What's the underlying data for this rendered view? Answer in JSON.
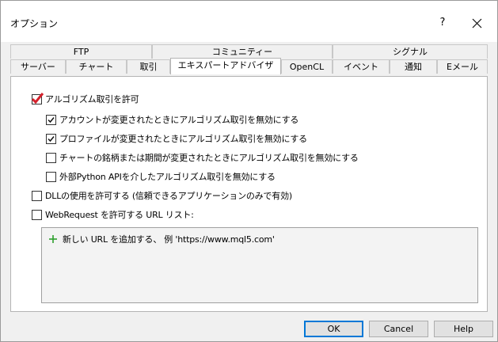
{
  "window": {
    "title": "オプション",
    "help_label": "?"
  },
  "tabs": {
    "row1": [
      {
        "label": "FTP"
      },
      {
        "label": "コミュニティー"
      },
      {
        "label": "シグナル"
      }
    ],
    "row2": [
      {
        "label": "サーバー"
      },
      {
        "label": "チャート"
      },
      {
        "label": "取引"
      },
      {
        "label": "エキスパートアドバイザ",
        "active": true
      },
      {
        "label": "OpenCL"
      },
      {
        "label": "イベント"
      },
      {
        "label": "通知"
      },
      {
        "label": "Eメール"
      }
    ]
  },
  "options": {
    "allow_algo": {
      "label": "アルゴリズム取引を許可",
      "checked": true
    },
    "disable_on_account": {
      "label": "アカウントが変更されたときにアルゴリズム取引を無効にする",
      "checked": true
    },
    "disable_on_profile": {
      "label": "プロファイルが変更されたときにアルゴリズム取引を無効にする",
      "checked": true
    },
    "disable_on_symbol": {
      "label": "チャートの銘柄または期間が変更されたときにアルゴリズム取引を無効にする",
      "checked": false
    },
    "disable_python": {
      "label": "外部Python APIを介したアルゴリズム取引を無効にする",
      "checked": false
    },
    "allow_dll": {
      "label": "DLLの使用を許可する (信頼できるアプリケーションのみで有効)",
      "checked": false
    },
    "allow_webrequest": {
      "label": "WebRequest を許可する URL リスト:",
      "checked": false
    }
  },
  "url_list": {
    "add_hint": "新しい URL を追加する、 例 'https://www.mql5.com'"
  },
  "buttons": {
    "ok": "OK",
    "cancel": "Cancel",
    "help": "Help"
  },
  "colors": {
    "red_check": "#d4202b",
    "plus_green": "#2ca02c",
    "focus_blue": "#0078d7"
  }
}
